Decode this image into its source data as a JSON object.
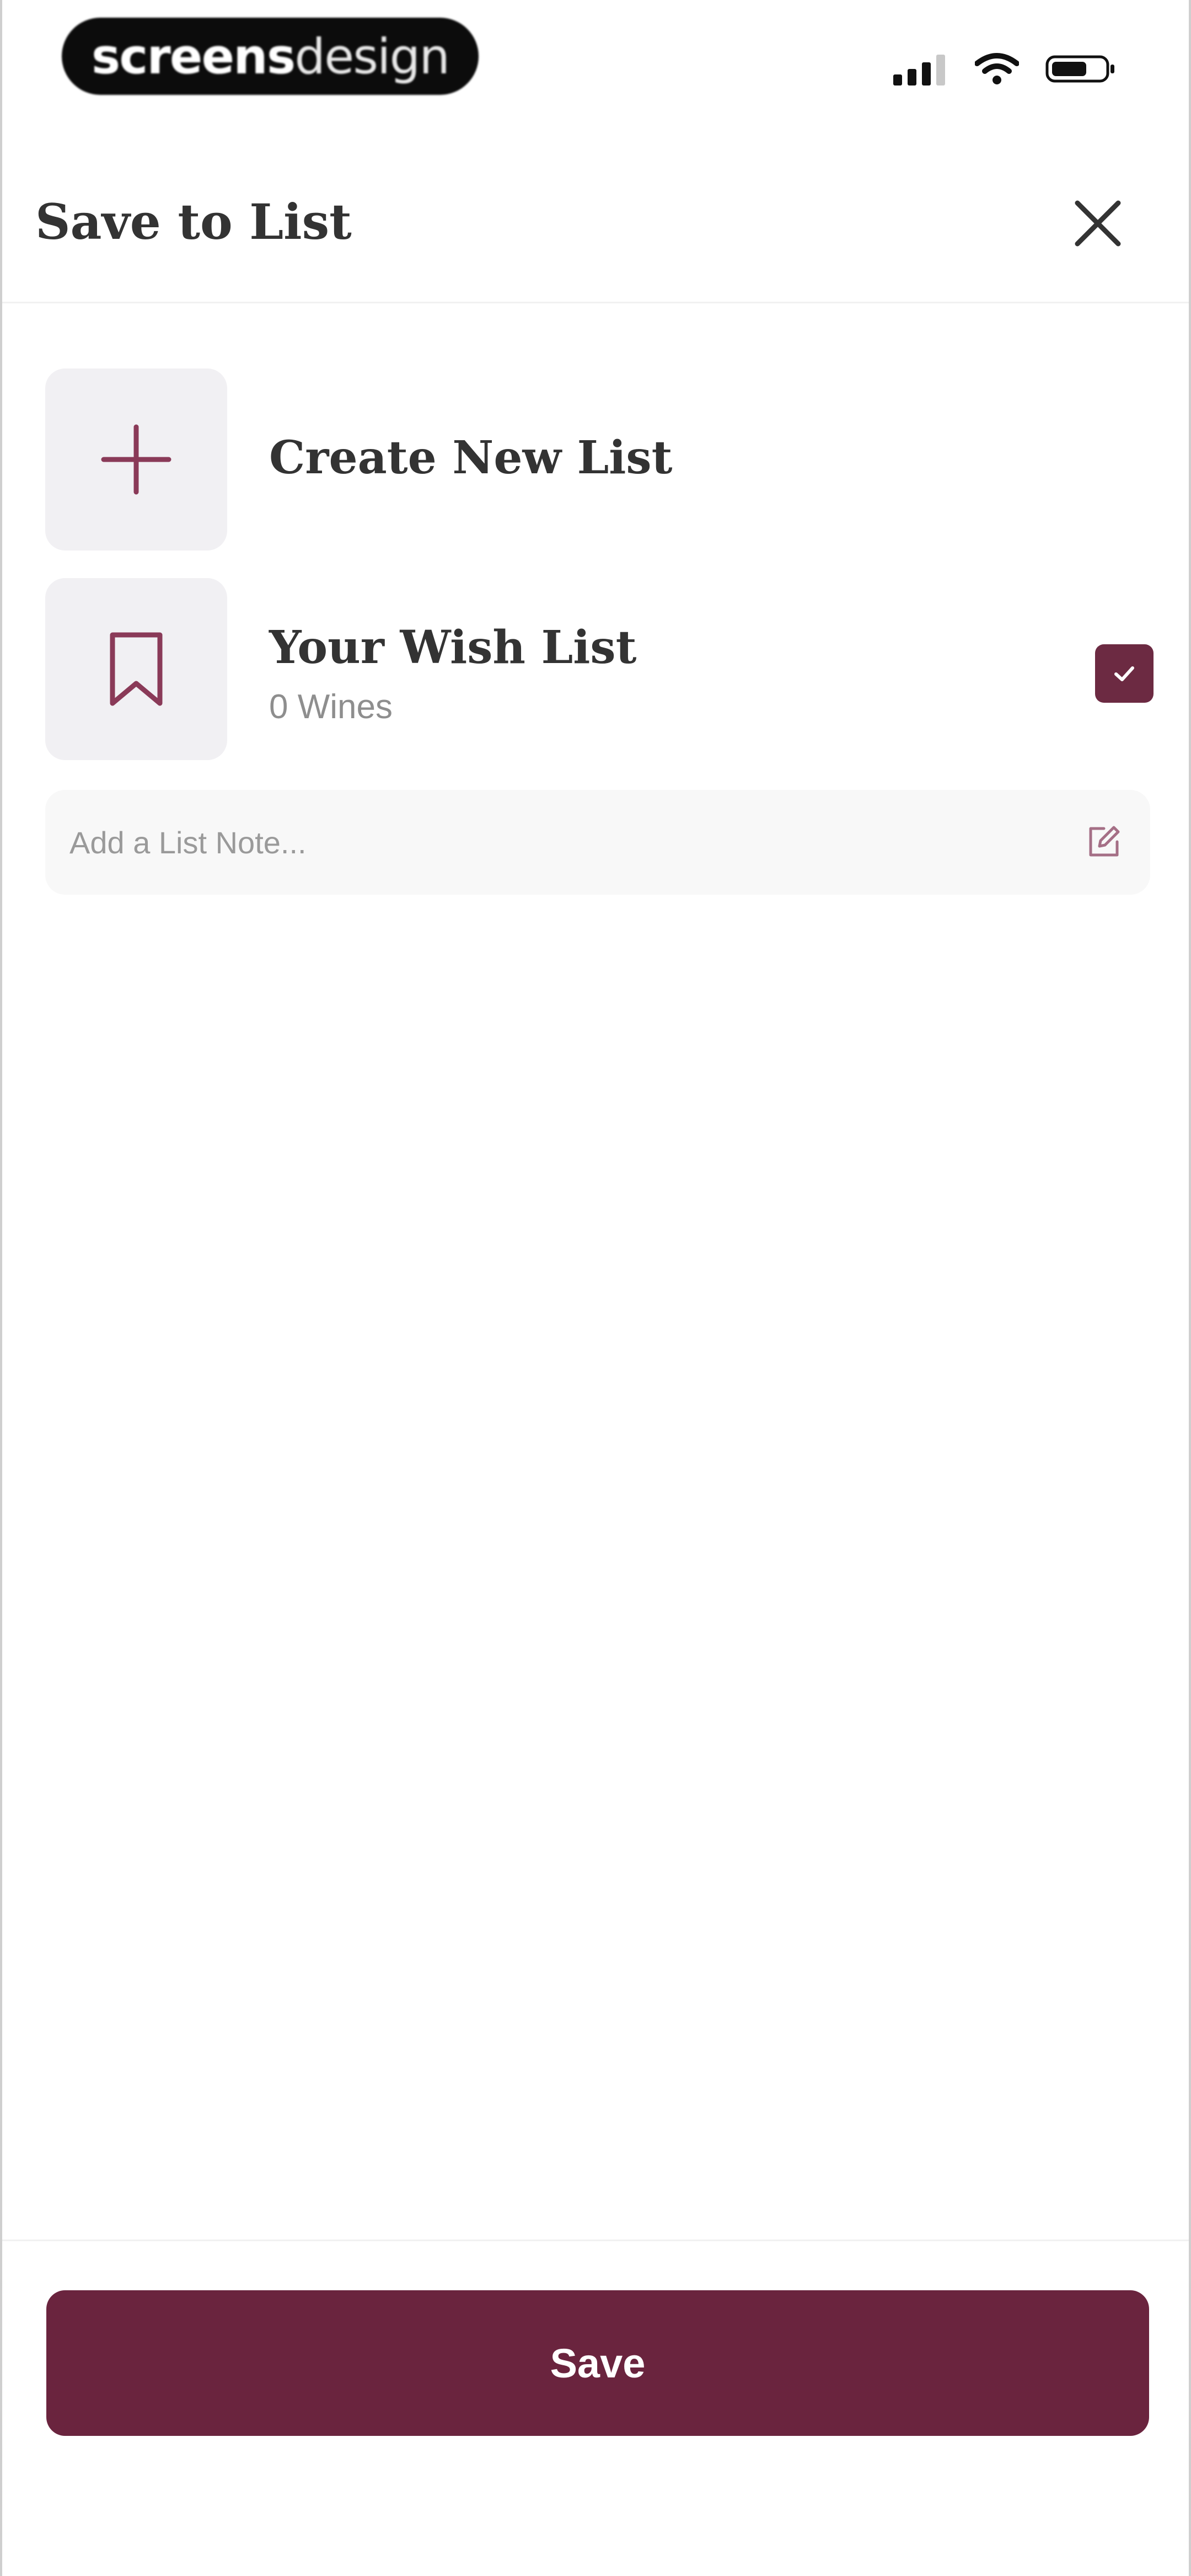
{
  "status_bar": {
    "brand_bold": "screens",
    "brand_light": "design",
    "icons": [
      "cellular-signal-icon",
      "wifi-icon",
      "battery-icon"
    ]
  },
  "header": {
    "title": "Save to List",
    "close_icon": "close-icon"
  },
  "lists": [
    {
      "title": "Create New List",
      "icon": "plus-icon"
    },
    {
      "title": "Your Wish List",
      "subtitle": "0 Wines",
      "icon": "bookmark-icon",
      "checked": true
    }
  ],
  "note": {
    "placeholder": "Add a List Note...",
    "icon": "edit-note-icon"
  },
  "footer": {
    "save_label": "Save"
  },
  "colors": {
    "accent": "#6a243e",
    "tile_background": "#f1f0f3",
    "note_background": "#f8f8f8",
    "title_text": "#333333",
    "secondary_text": "#8e8e8e"
  }
}
